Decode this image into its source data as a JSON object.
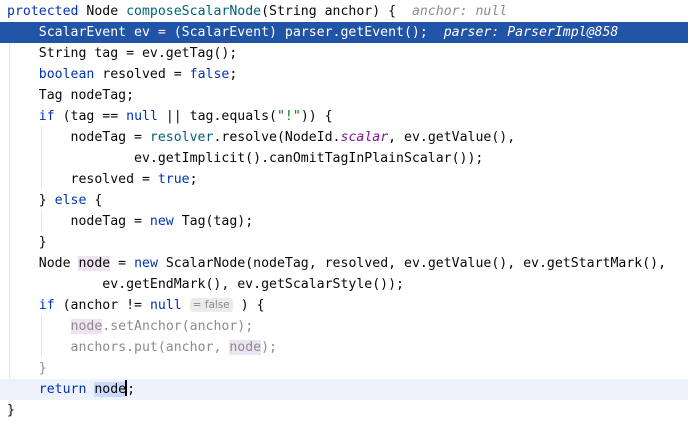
{
  "editor": {
    "lines": [
      {
        "parts": [
          [
            "kw",
            "protected"
          ],
          [
            "plain",
            " Node "
          ],
          [
            "fn",
            "composeScalarNode"
          ],
          [
            "plain",
            "(String anchor) {  "
          ],
          [
            "hint",
            "anchor: null"
          ]
        ]
      },
      {
        "parts": [
          [
            "plain",
            "    ScalarEvent ev = (ScalarEvent) parser.getEvent();  "
          ],
          [
            "hint-exec",
            "parser: ParserImpl@858"
          ]
        ]
      },
      {
        "parts": [
          [
            "plain",
            "    String tag = ev.getTag();"
          ]
        ]
      },
      {
        "parts": [
          [
            "plain",
            "    "
          ],
          [
            "kw",
            "boolean"
          ],
          [
            "plain",
            " resolved = "
          ],
          [
            "kw",
            "false"
          ],
          [
            "plain",
            ";"
          ]
        ]
      },
      {
        "parts": [
          [
            "plain",
            "    Tag nodeTag;"
          ]
        ]
      },
      {
        "parts": [
          [
            "plain",
            "    "
          ],
          [
            "kw",
            "if"
          ],
          [
            "plain",
            " (tag == "
          ],
          [
            "kw",
            "null"
          ],
          [
            "plain",
            " || tag.equals("
          ],
          [
            "str",
            "\"!\""
          ],
          [
            "plain",
            ")) {"
          ]
        ]
      },
      {
        "parts": [
          [
            "plain",
            "        nodeTag = "
          ],
          [
            "fn",
            "resolver"
          ],
          [
            "plain",
            ".resolve(NodeId."
          ],
          [
            "field",
            "scalar"
          ],
          [
            "plain",
            ", ev.getValue(),"
          ]
        ]
      },
      {
        "parts": [
          [
            "plain",
            "                ev.getImplicit().canOmitTagInPlainScalar());"
          ]
        ]
      },
      {
        "parts": [
          [
            "plain",
            "        resolved = "
          ],
          [
            "kw",
            "true"
          ],
          [
            "plain",
            ";"
          ]
        ]
      },
      {
        "parts": [
          [
            "plain",
            "    } "
          ],
          [
            "kw",
            "else"
          ],
          [
            "plain",
            " {"
          ]
        ]
      },
      {
        "parts": [
          [
            "plain",
            "        nodeTag = "
          ],
          [
            "kw",
            "new"
          ],
          [
            "plain",
            " Tag(tag);"
          ]
        ]
      },
      {
        "parts": [
          [
            "plain",
            "    }"
          ]
        ]
      },
      {
        "parts": [
          [
            "plain",
            "    Node "
          ],
          [
            "local-mark",
            "node"
          ],
          [
            "plain",
            " = "
          ],
          [
            "kw",
            "new"
          ],
          [
            "plain",
            " ScalarNode(nodeTag, resolved, ev.getValue(), ev.getStartMark(),"
          ]
        ]
      },
      {
        "parts": [
          [
            "plain",
            "            ev.getEndMark(), ev.getScalarStyle());"
          ]
        ]
      },
      {
        "parts": [
          [
            "plain",
            "    "
          ],
          [
            "kw",
            "if"
          ],
          [
            "plain",
            " (anchor != "
          ],
          [
            "kw",
            "null"
          ],
          [
            "plain",
            " "
          ],
          [
            "inlay",
            "= false"
          ],
          [
            "plain",
            " ) {"
          ]
        ]
      },
      {
        "parts": [
          [
            "plain",
            "        "
          ],
          [
            "dim-var",
            "node"
          ],
          [
            "dim",
            ".setAnchor(anchor);"
          ]
        ]
      },
      {
        "parts": [
          [
            "plain",
            "        "
          ],
          [
            "dim",
            "anchors.put(anchor, "
          ],
          [
            "dim-var",
            "node"
          ],
          [
            "dim",
            ");"
          ]
        ]
      },
      {
        "parts": [
          [
            "dim",
            "    }"
          ]
        ]
      },
      {
        "parts": [
          [
            "plain",
            "    "
          ],
          [
            "kw",
            "return"
          ],
          [
            "plain",
            " "
          ],
          [
            "sel-word",
            "node"
          ],
          [
            "caret",
            ""
          ],
          [
            "plain",
            ";"
          ]
        ]
      },
      {
        "parts": [
          [
            "plain",
            "}"
          ]
        ]
      }
    ]
  }
}
